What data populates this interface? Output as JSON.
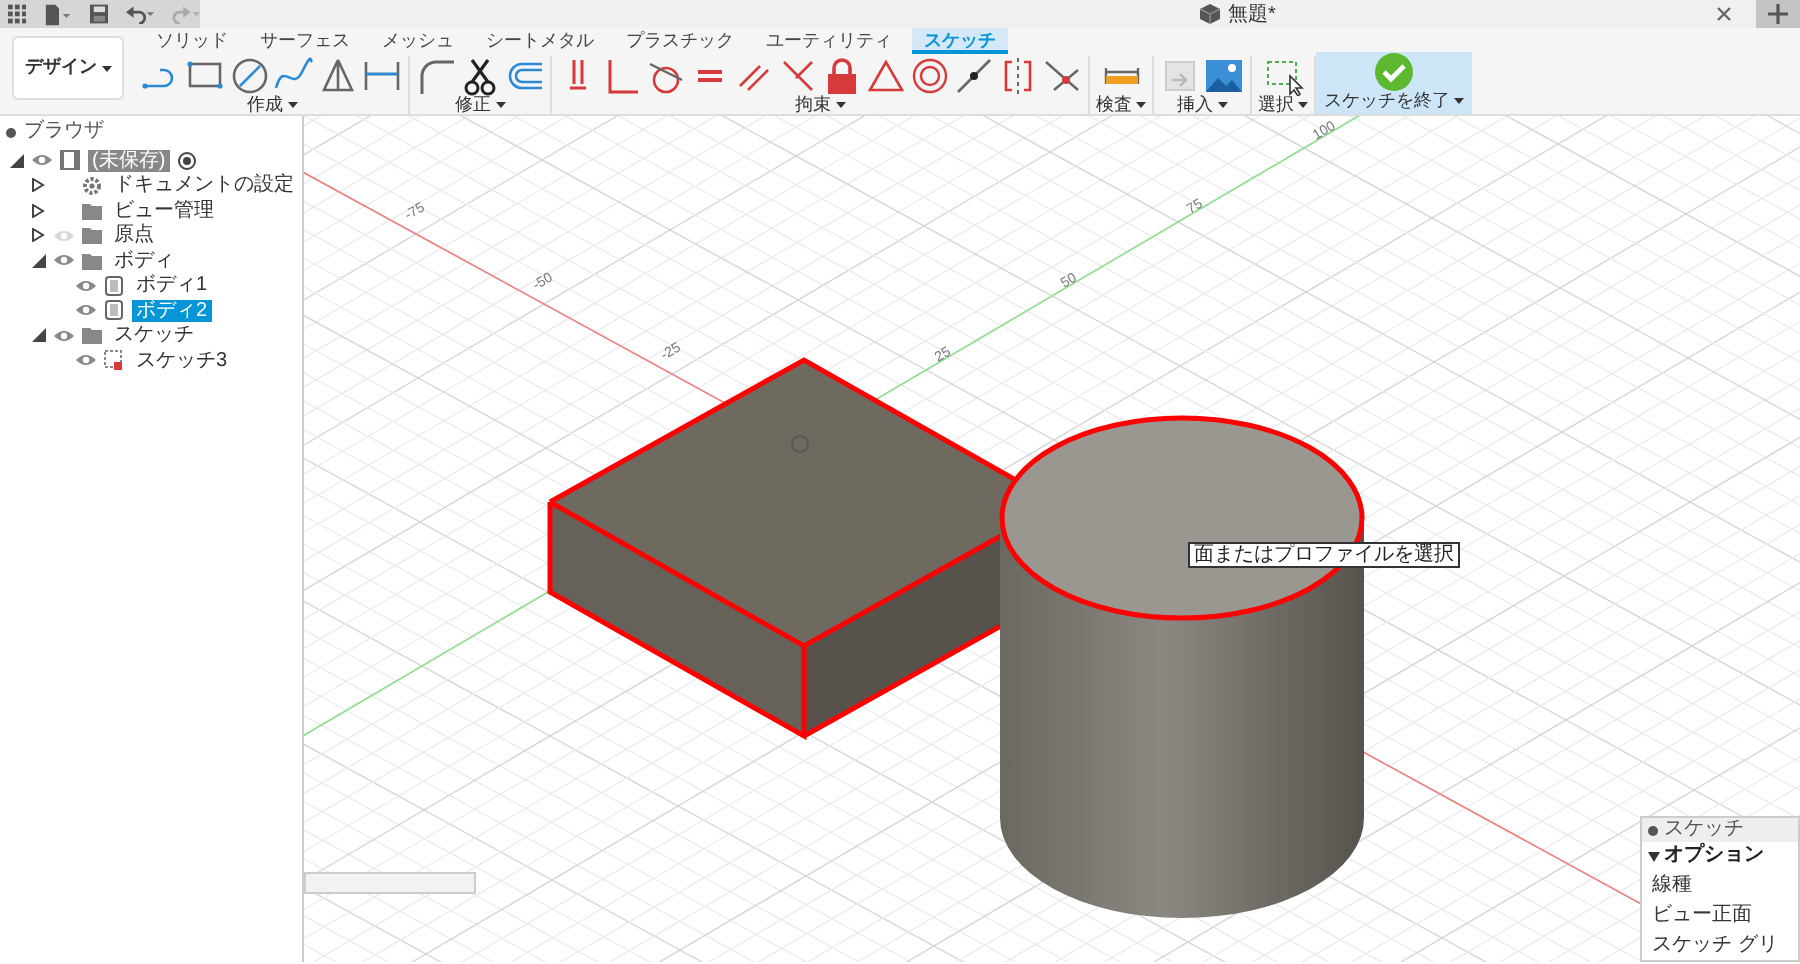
{
  "top_bar": {
    "title": "無題*"
  },
  "workspace_button": {
    "label": "デザイン"
  },
  "tabs": [
    {
      "label": "ソリッド",
      "selected": false
    },
    {
      "label": "サーフェス",
      "selected": false
    },
    {
      "label": "メッシュ",
      "selected": false
    },
    {
      "label": "シートメタル",
      "selected": false
    },
    {
      "label": "プラスチック",
      "selected": false
    },
    {
      "label": "ユーティリティ",
      "selected": false
    },
    {
      "label": "スケッチ",
      "selected": true
    }
  ],
  "tool_groups": [
    {
      "label": "作成",
      "kind": "tools"
    },
    {
      "label": "修正",
      "kind": "tools"
    },
    {
      "label": "拘束",
      "kind": "tools"
    },
    {
      "label": "検査",
      "kind": "tools"
    },
    {
      "label": "挿入",
      "kind": "tools"
    },
    {
      "label": "選択",
      "kind": "tools"
    },
    {
      "label": "スケッチを終了",
      "kind": "finish"
    }
  ],
  "browser": {
    "title": "ブラウザ",
    "tree": [
      {
        "label": "(未保存)",
        "kind": "document",
        "expanded": true,
        "visible": true,
        "selected": false,
        "children": [
          {
            "label": "ドキュメントの設定",
            "kind": "settings",
            "expanded": false,
            "selected": false
          },
          {
            "label": "ビュー管理",
            "kind": "folder",
            "expanded": false,
            "selected": false
          },
          {
            "label": "原点",
            "kind": "folder",
            "expanded": false,
            "visible": false,
            "selected": false
          },
          {
            "label": "ボディ",
            "kind": "folder",
            "expanded": true,
            "visible": true,
            "selected": false,
            "children": [
              {
                "label": "ボディ1",
                "kind": "body",
                "visible": true,
                "selected": false
              },
              {
                "label": "ボディ2",
                "kind": "body",
                "visible": true,
                "selected": true
              }
            ]
          },
          {
            "label": "スケッチ",
            "kind": "folder",
            "expanded": true,
            "visible": true,
            "selected": false,
            "children": [
              {
                "label": "スケッチ3",
                "kind": "sketch",
                "visible": true,
                "selected": false
              }
            ]
          }
        ]
      }
    ]
  },
  "viewport": {
    "x_axis_labels": [
      "-75",
      "-50",
      "-25"
    ],
    "y_axis_labels": [
      "25",
      "50",
      "75",
      "100"
    ],
    "tooltip": "面またはプロファイルを選択"
  },
  "sketch_palette": {
    "title": "スケッチ",
    "section": "オプション",
    "rows": [
      "線種",
      "ビュー正面",
      "スケッチ グリ"
    ]
  }
}
